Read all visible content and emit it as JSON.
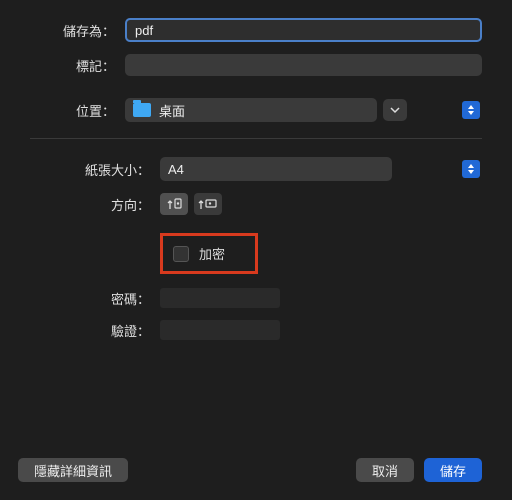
{
  "labels": {
    "save_as": "儲存為：",
    "tags": "標記：",
    "location": "位置：",
    "paper_size": "紙張大小：",
    "orientation": "方向：",
    "encrypt": "加密",
    "password": "密碼：",
    "verify": "驗證："
  },
  "values": {
    "filename": "pdf",
    "location": "桌面",
    "paper_size": "A4"
  },
  "buttons": {
    "hide_details": "隱藏詳細資訊",
    "cancel": "取消",
    "save": "儲存"
  },
  "colors": {
    "accent": "#1e63d6",
    "highlight_box": "#d83a1e"
  }
}
